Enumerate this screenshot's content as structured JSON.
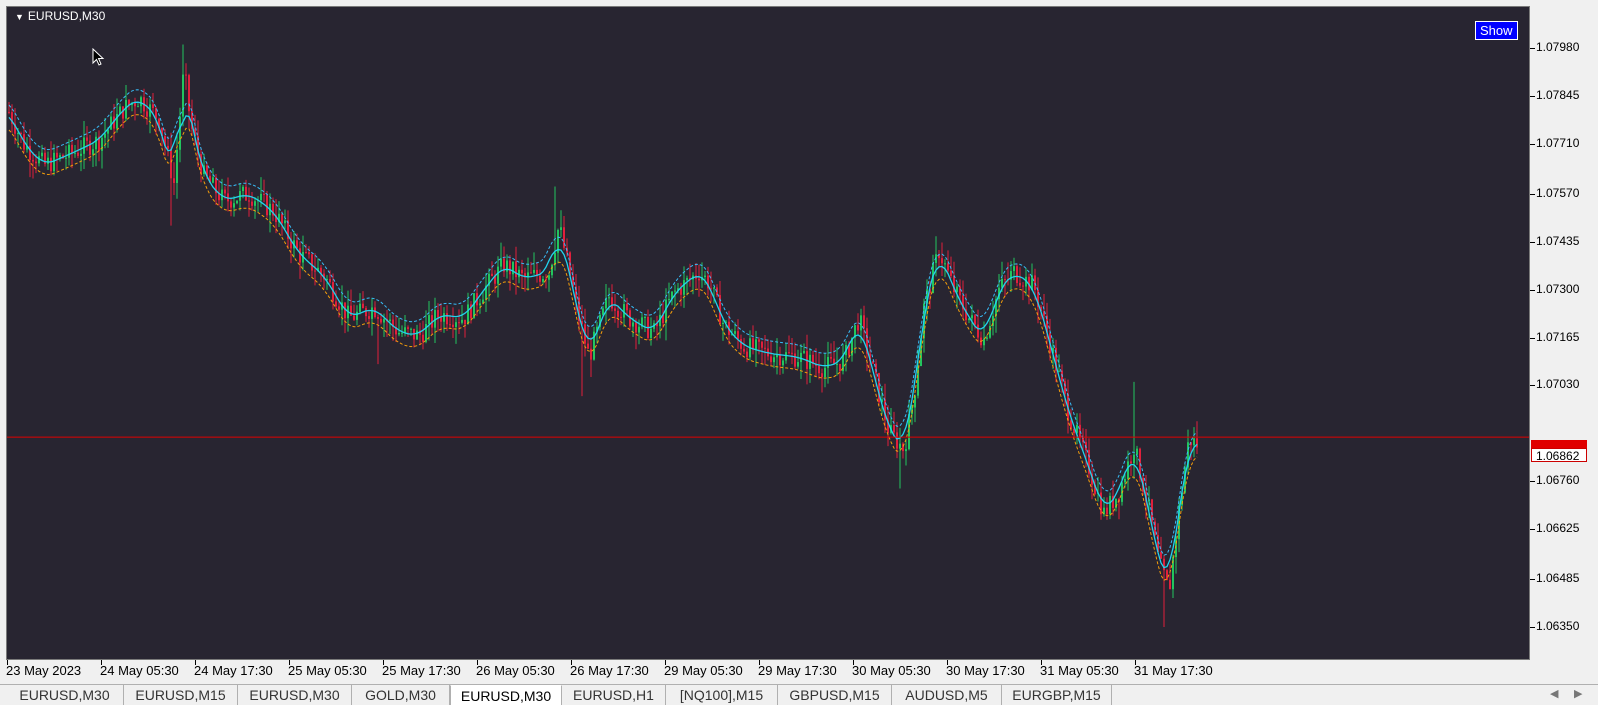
{
  "chart": {
    "symbol_title": "EURUSD,M30",
    "show_button": "Show",
    "bid_price": "1.06862",
    "colors": {
      "background": "#282531",
      "bull": "#22c55e",
      "bear": "#e0203c",
      "ma": "#22d3ee",
      "upper_band": "#38bdf8",
      "lower_band": "#f59e0b",
      "bid_line": "#e00000"
    }
  },
  "price_axis": [
    "1.07980",
    "1.07845",
    "1.07710",
    "1.07570",
    "1.07435",
    "1.07300",
    "1.07165",
    "1.07030",
    "1.06760",
    "1.06625",
    "1.06485",
    "1.06350"
  ],
  "time_axis": [
    "23 May 2023",
    "24 May 05:30",
    "24 May 17:30",
    "25 May 05:30",
    "25 May 17:30",
    "26 May 05:30",
    "26 May 17:30",
    "29 May 05:30",
    "29 May 17:30",
    "30 May 05:30",
    "30 May 17:30",
    "31 May 05:30",
    "31 May 17:30"
  ],
  "tabs": [
    {
      "label": "EURUSD,M30",
      "active": false
    },
    {
      "label": "EURUSD,M15",
      "active": false
    },
    {
      "label": "EURUSD,M30",
      "active": false
    },
    {
      "label": "GOLD,M30",
      "active": false
    },
    {
      "label": "EURUSD,M30",
      "active": true
    },
    {
      "label": "EURUSD,H1",
      "active": false
    },
    {
      "label": "[NQ100],M15",
      "active": false
    },
    {
      "label": "GBPUSD,M15",
      "active": false
    },
    {
      "label": "AUDUSD,M5",
      "active": false
    },
    {
      "label": "EURGBP,M15",
      "active": false
    }
  ],
  "chart_data": {
    "type": "candlestick",
    "symbol": "EURUSD",
    "timeframe": "M30",
    "ylim": [
      1.063,
      1.0805
    ],
    "current_price": 1.06862,
    "price_path": [
      [
        0,
        1.078
      ],
      [
        15,
        1.0771
      ],
      [
        35,
        1.0765
      ],
      [
        60,
        1.0768
      ],
      [
        90,
        1.0772
      ],
      [
        115,
        1.0781
      ],
      [
        130,
        1.0784
      ],
      [
        150,
        1.0778
      ],
      [
        165,
        1.076
      ],
      [
        175,
        1.0792
      ],
      [
        182,
        1.0776
      ],
      [
        195,
        1.0762
      ],
      [
        215,
        1.0755
      ],
      [
        240,
        1.0757
      ],
      [
        265,
        1.0752
      ],
      [
        290,
        1.074
      ],
      [
        315,
        1.0734
      ],
      [
        340,
        1.0722
      ],
      [
        365,
        1.0725
      ],
      [
        390,
        1.0718
      ],
      [
        410,
        1.0717
      ],
      [
        430,
        1.0723
      ],
      [
        455,
        1.0722
      ],
      [
        475,
        1.073
      ],
      [
        495,
        1.0737
      ],
      [
        515,
        1.0733
      ],
      [
        540,
        1.0735
      ],
      [
        550,
        1.0748
      ],
      [
        558,
        1.0738
      ],
      [
        570,
        1.0722
      ],
      [
        580,
        1.0711
      ],
      [
        600,
        1.0728
      ],
      [
        620,
        1.0722
      ],
      [
        645,
        1.0718
      ],
      [
        665,
        1.0729
      ],
      [
        690,
        1.0735
      ],
      [
        700,
        1.0732
      ],
      [
        715,
        1.072
      ],
      [
        735,
        1.0714
      ],
      [
        760,
        1.0712
      ],
      [
        790,
        1.0711
      ],
      [
        815,
        1.0708
      ],
      [
        835,
        1.071
      ],
      [
        850,
        1.0722
      ],
      [
        865,
        1.0706
      ],
      [
        880,
        1.069
      ],
      [
        895,
        1.0685
      ],
      [
        905,
        1.07
      ],
      [
        915,
        1.0725
      ],
      [
        930,
        1.0741
      ],
      [
        945,
        1.073
      ],
      [
        960,
        1.0722
      ],
      [
        975,
        1.0716
      ],
      [
        990,
        1.073
      ],
      [
        1005,
        1.0735
      ],
      [
        1025,
        1.0731
      ],
      [
        1040,
        1.0716
      ],
      [
        1060,
        1.0695
      ],
      [
        1080,
        1.068
      ],
      [
        1095,
        1.0667
      ],
      [
        1110,
        1.0673
      ],
      [
        1125,
        1.0686
      ],
      [
        1140,
        1.0668
      ],
      [
        1150,
        1.0653
      ],
      [
        1160,
        1.0645
      ],
      [
        1170,
        1.0668
      ],
      [
        1180,
        1.0688
      ],
      [
        1190,
        1.0686
      ]
    ]
  }
}
